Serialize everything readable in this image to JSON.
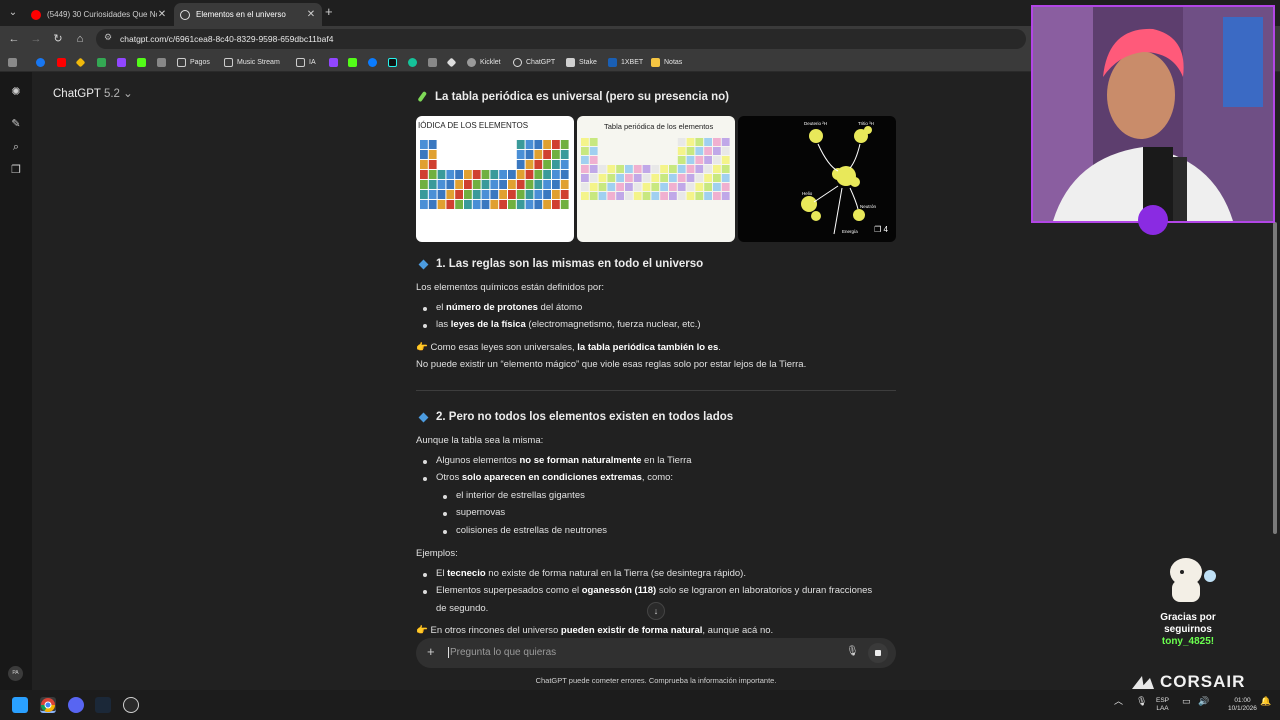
{
  "browser": {
    "tabs": [
      {
        "title": "(5449) 30 Curiosidades Que No",
        "favicon": "youtube-icon",
        "active": false
      },
      {
        "title": "Elementos en el universo",
        "favicon": "chatgpt-icon",
        "active": true
      }
    ],
    "url": "chatgpt.com/c/6961cea8-8c40-8329-9598-659dbc11baf4",
    "bookmarks": [
      {
        "label": "Pagos",
        "icon": "folder-icon"
      },
      {
        "label": "Music Stream",
        "icon": "folder-icon"
      },
      {
        "label": "IA",
        "icon": "folder-icon"
      },
      {
        "label": "Kicklet",
        "icon": "kicklet-icon"
      },
      {
        "label": "ChatGPT",
        "icon": "chatgpt-icon"
      },
      {
        "label": "Stake",
        "icon": "stake-icon"
      },
      {
        "label": "1XBET",
        "icon": "1xbet-icon"
      },
      {
        "label": "Notas",
        "icon": "notes-icon"
      }
    ]
  },
  "chatgpt": {
    "model_name": "ChatGPT",
    "model_version": "5.2",
    "avatar_initials": "PA",
    "composer_placeholder": "Pregunta lo que quieras",
    "disclaimer": "ChatGPT puede cometer errores. Comprueba la información importante."
  },
  "article": {
    "heading_main": "La tabla periódica es universal (pero su presencia no)",
    "image_count": "4",
    "section1": {
      "title": "1. Las reglas son las mismas en todo el universo",
      "intro": "Los elementos químicos están definidos por:",
      "li1_pre": "el ",
      "li1_bold": "número de protones",
      "li1_post": " del átomo",
      "li2_pre": "las ",
      "li2_bold": "leyes de la física",
      "li2_post": " (electromagnetismo, fuerza nuclear, etc.)",
      "note_pre": "Como esas leyes son universales, ",
      "note_bold": "la tabla periódica también lo es",
      "note_post": ".",
      "note2": "No puede existir un “elemento mágico” que viole esas reglas solo por estar lejos de la Tierra."
    },
    "section2": {
      "title": "2. Pero no todos los elementos existen en todos lados",
      "intro": "Aunque la tabla sea la misma:",
      "li1_pre": "Algunos elementos ",
      "li1_bold": "no se forman naturalmente",
      "li1_post": " en la Tierra",
      "li2_pre": "Otros ",
      "li2_bold": "solo aparecen en condiciones extremas",
      "li2_post": ", como:",
      "sub1": "el interior de estrellas gigantes",
      "sub2": "supernovas",
      "sub3": "colisiones de estrellas de neutrones",
      "examples_label": "Ejemplos:",
      "ex1_pre": "El ",
      "ex1_bold": "tecnecio",
      "ex1_post": " no existe de forma natural en la Tierra (se desintegra rápido).",
      "ex2_pre": "Elementos superpesados como el ",
      "ex2_bold": "oganessón (118)",
      "ex2_post": " solo se lograron en laboratorios y duran fracciones",
      "ex2_line2": "de segundo.",
      "last_pre": "En otros rincones del universo ",
      "last_bold": "pueden existir de forma natural",
      "last_post": ", aunque acá no."
    }
  },
  "overlay": {
    "thanks_line1": "Gracias por",
    "thanks_line2": "seguirnos",
    "username": "tony_4825!",
    "brand": "CORSAIR",
    "accent": "#b246e6"
  },
  "taskbar": {
    "lang_line1": "ESP",
    "lang_line2": "LAA",
    "time": "01:00",
    "date": "10/1/2026"
  }
}
